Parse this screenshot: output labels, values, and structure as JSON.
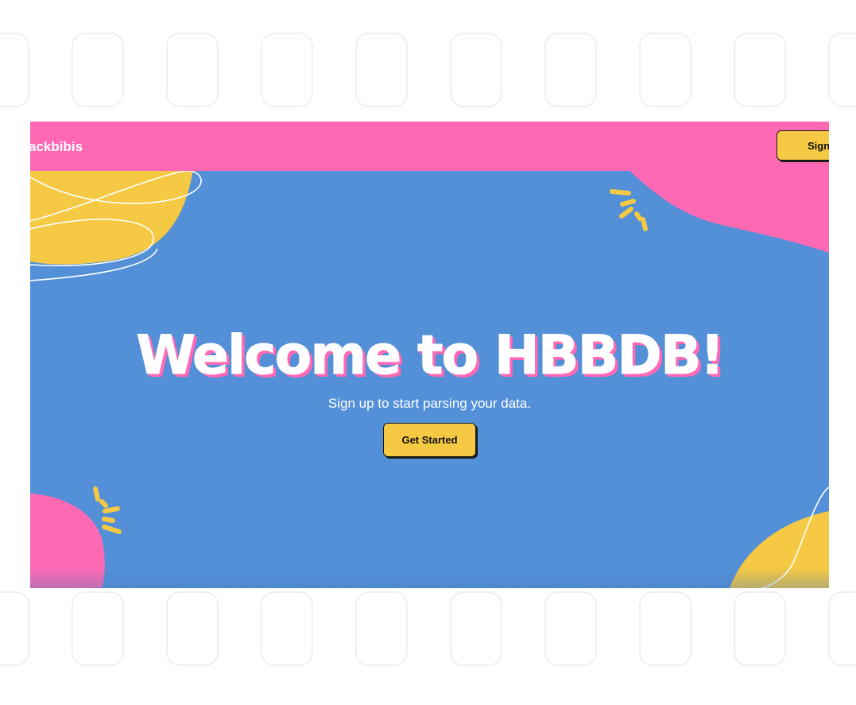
{
  "navbar": {
    "brand": "ackbibis",
    "signup_label": "Sign"
  },
  "hero": {
    "headline": "Welcome to HBBDB!",
    "subtitle": "Sign up to start parsing your data.",
    "cta_label": "Get Started"
  },
  "colors": {
    "pink": "#ff69b4",
    "blue": "#5390d8",
    "yellow": "#f5c944",
    "white": "#ffffff"
  }
}
